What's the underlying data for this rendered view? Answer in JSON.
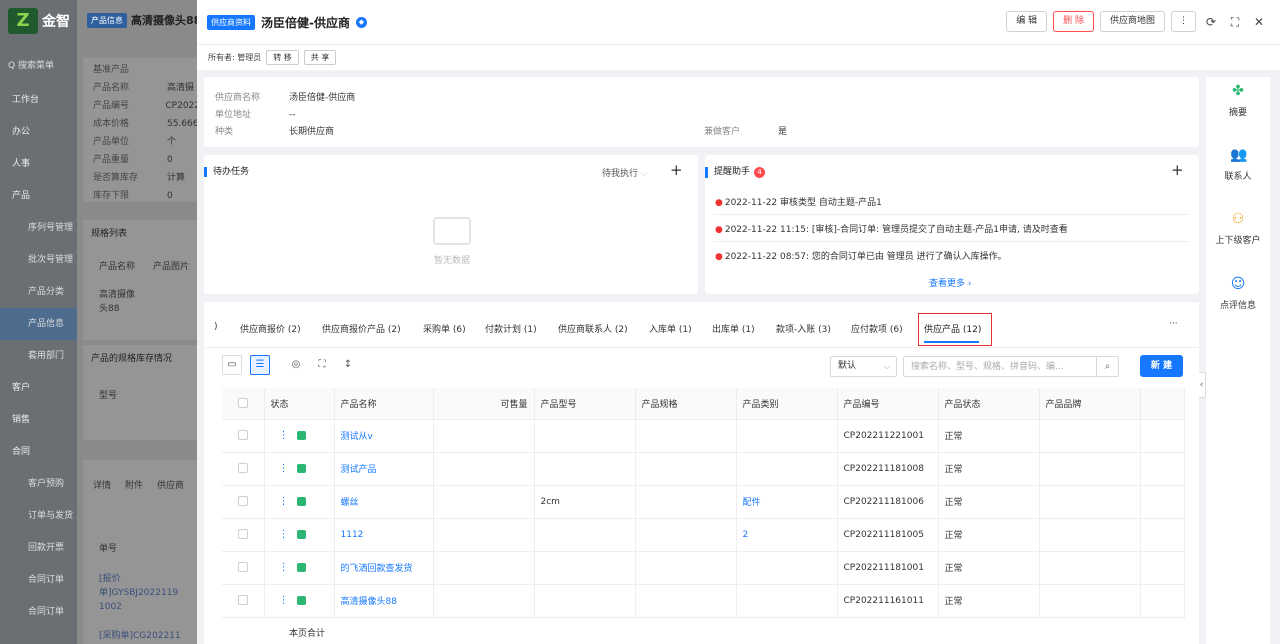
{
  "bg": {
    "logo": "金智",
    "search": "Q 搜索菜单",
    "menu": [
      "工作台",
      "办公",
      "人事",
      "产品",
      "序列号管理",
      "批次号管理",
      "产品分类",
      "产品信息",
      "套用部门",
      "客户",
      "销售",
      "合同",
      "客户预购",
      "订单与发货",
      "回款开票",
      "合同订单",
      "合同订单"
    ],
    "header_tag": "产品信息",
    "header_title": "高清摄像头88",
    "fields": [
      {
        "k": "基准产品",
        "v": ""
      },
      {
        "k": "产品名称",
        "v": "高清摄"
      },
      {
        "k": "产品编号",
        "v": "CP2022"
      },
      {
        "k": "成本价格",
        "v": "55.666"
      },
      {
        "k": "产品单位",
        "v": "个"
      },
      {
        "k": "产品重量",
        "v": "0"
      },
      {
        "k": "是否算库存",
        "v": "计算"
      },
      {
        "k": "库存下限",
        "v": "0"
      }
    ],
    "spec_title": "规格列表",
    "spec_head": [
      "产品名称",
      "产品图片"
    ],
    "spec_row": "高清摄像头88",
    "stock_title": "产品的规格库存情况",
    "stock_head": "型号",
    "bottom_tabs": [
      "详情",
      "附件",
      "供应商"
    ],
    "order_head": "单号",
    "order_rows": [
      "[报价单]GYSBJ2022119 1002",
      "[采购单]CG202211"
    ]
  },
  "topbar": {
    "tag": "供应商资料",
    "title": "汤臣倍健-供应商",
    "flag": "◆",
    "edit": "编 辑",
    "delete": "删 除",
    "map": "供应商地图",
    "more": "⋮"
  },
  "owner": {
    "label": "所有者: 管理员",
    "transfer": "转 移",
    "share": "共 享"
  },
  "info": {
    "name_k": "供应商名称",
    "name_v": "汤臣倍健-供应商",
    "addr_k": "单位地址",
    "addr_v": "--",
    "type_k": "种类",
    "type_v": "长期供应商",
    "also_k": "兼做客户",
    "also_v": "是"
  },
  "tasks": {
    "title": "待办任务",
    "filter": "待我执行",
    "empty": "暂无数据"
  },
  "reminder": {
    "title": "提醒助手",
    "count": "4",
    "items": [
      "2022-11-22        审核类型 自动主题-产品1",
      "2022-11-22 11:15: [审核]-合同订单: 管理员提交了自动主题-产品1申请, 请及时查看",
      "2022-11-22 08:57: 您的合同订单已由 管理员 进行了确认入库操作。"
    ],
    "more": "查看更多 ›"
  },
  "side": {
    "items": [
      "摘要",
      "联系人",
      "上下级客户",
      "点评信息"
    ]
  },
  "tabs": {
    "lead": ")",
    "items": [
      "供应商报价 (2)",
      "供应商报价产品 (2)",
      "采购单 (6)",
      "付款计划 (1)",
      "供应商联系人 (2)",
      "入库单 (1)",
      "出库单 (1)",
      "款项-入账 (3)",
      "应付款项 (6)",
      "供应产品 (12)"
    ],
    "more": "···"
  },
  "toolbar": {
    "select": "默认",
    "search_placeholder": "搜索名称、型号、规格、拼音码、编...",
    "new": "新 建"
  },
  "table": {
    "columns": [
      "状态",
      "产品名称",
      "可售量",
      "产品型号",
      "产品规格",
      "产品类别",
      "产品编号",
      "产品状态",
      "产品品牌"
    ],
    "rows": [
      {
        "name": "测试从v",
        "qty": "",
        "model": "",
        "spec": "",
        "cat": "",
        "code": "CP202211221001",
        "status": "正常",
        "brand": ""
      },
      {
        "name": "测试产品",
        "qty": "",
        "model": "",
        "spec": "",
        "cat": "",
        "code": "CP202211181008",
        "status": "正常",
        "brand": ""
      },
      {
        "name": "螺丝",
        "qty": "",
        "model": "2cm",
        "spec": "",
        "cat": "配件",
        "code": "CP202211181006",
        "status": "正常",
        "brand": ""
      },
      {
        "name": "1112",
        "qty": "",
        "model": "",
        "spec": "",
        "cat": "2",
        "code": "CP202211181005",
        "status": "正常",
        "brand": ""
      },
      {
        "name": "的飞洒回款查发货",
        "qty": "",
        "model": "",
        "spec": "",
        "cat": "",
        "code": "CP202211181001",
        "status": "正常",
        "brand": ""
      },
      {
        "name": "高清摄像头88",
        "qty": "",
        "model": "",
        "spec": "",
        "cat": "",
        "code": "CP202211161011",
        "status": "正常",
        "brand": ""
      }
    ],
    "footer": "本页合计"
  }
}
